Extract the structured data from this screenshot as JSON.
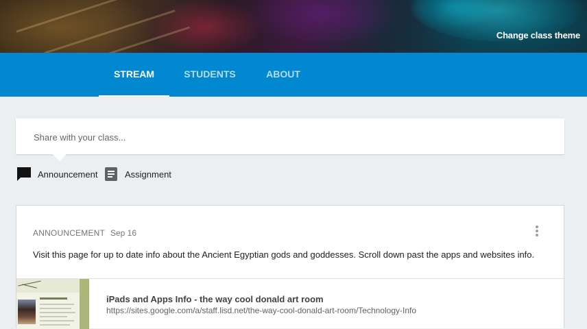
{
  "banner": {
    "change_theme_label": "Change class theme"
  },
  "tabs": [
    {
      "label": "STREAM",
      "active": true
    },
    {
      "label": "STUDENTS",
      "active": false
    },
    {
      "label": "ABOUT",
      "active": false
    }
  ],
  "share": {
    "placeholder": "Share with your class..."
  },
  "post_options": [
    {
      "label": "Announcement",
      "icon": "announcement-icon"
    },
    {
      "label": "Assignment",
      "icon": "assignment-icon"
    }
  ],
  "post": {
    "type": "ANNOUNCEMENT",
    "date": "Sep 16",
    "text": "Visit this page for up to date info about the Ancient Egyptian gods and goddesses. Scroll down past the apps and websites info.",
    "attachment": {
      "title": "iPads and Apps Info - the way cool donald art room",
      "url": "https://sites.google.com/a/staff.lisd.net/the-way-cool-donald-art-room/Technology-Info"
    }
  },
  "colors": {
    "accent": "#0288d1",
    "background": "#eceff1"
  }
}
